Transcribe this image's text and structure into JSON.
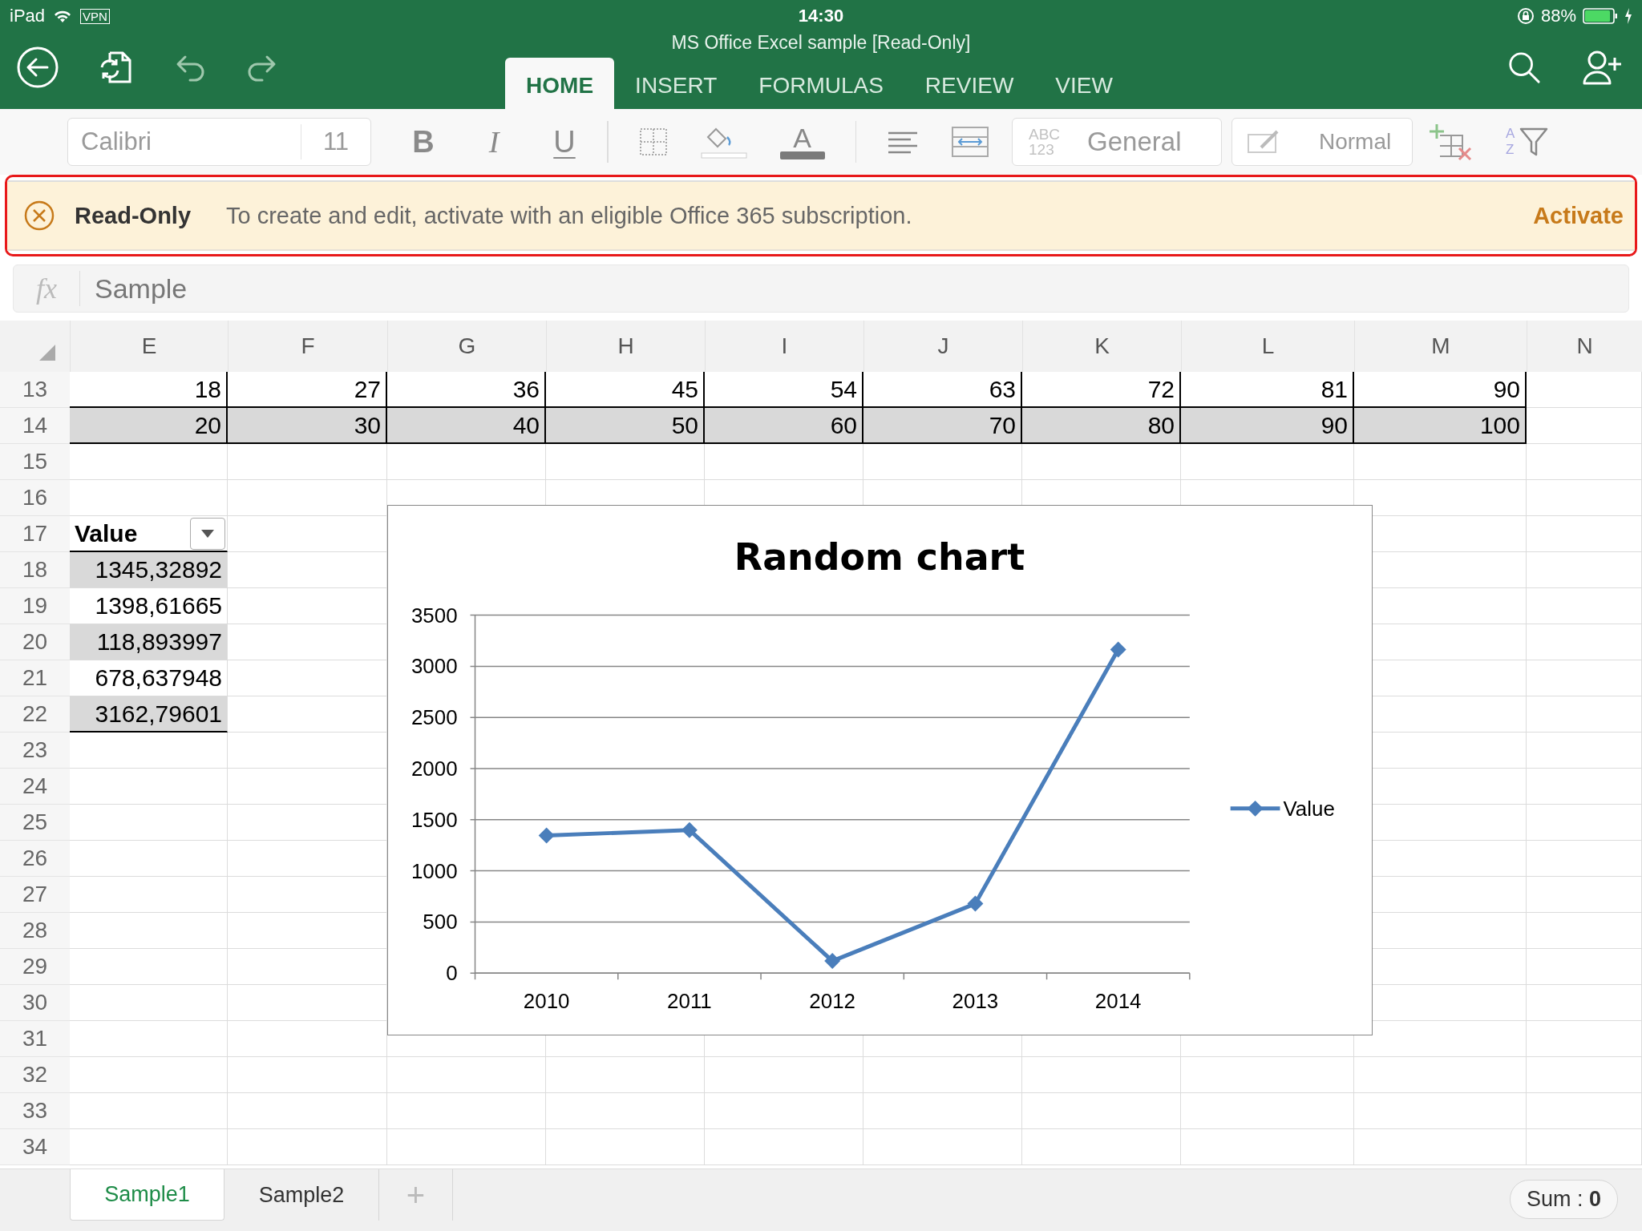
{
  "status_bar": {
    "device": "iPad",
    "vpn": "VPN",
    "time": "14:30",
    "battery": "88%"
  },
  "window": {
    "title": "MS Office Excel sample [Read-Only]"
  },
  "tabs": [
    {
      "label": "HOME",
      "selected": true
    },
    {
      "label": "INSERT",
      "selected": false
    },
    {
      "label": "FORMULAS",
      "selected": false
    },
    {
      "label": "REVIEW",
      "selected": false
    },
    {
      "label": "VIEW",
      "selected": false
    }
  ],
  "toolbar": {
    "font": "Calibri",
    "font_size": "11",
    "format_buttons": [
      {
        "label": "B",
        "kind": "bold"
      },
      {
        "label": "I",
        "kind": "italic"
      },
      {
        "label": "U",
        "kind": "underline"
      }
    ],
    "font_color_button": "A",
    "number_format_icon": [
      "ABC",
      "123"
    ],
    "number_format": "General",
    "cell_style": "Normal",
    "sort_letters": [
      "A",
      "Z"
    ]
  },
  "banner": {
    "title": "Read-Only",
    "message": "To create and edit, activate with an eligible Office 365 subscription.",
    "action": "Activate"
  },
  "formula_bar": {
    "icon": "fx",
    "value": "Sample"
  },
  "sheet": {
    "columns": [
      "E",
      "F",
      "G",
      "H",
      "I",
      "J",
      "K",
      "L",
      "M",
      "N"
    ],
    "rows": [
      {
        "number": "13",
        "kind": "band",
        "shaded": false,
        "values": [
          "18",
          "27",
          "36",
          "45",
          "54",
          "63",
          "72",
          "81",
          "90"
        ]
      },
      {
        "number": "14",
        "kind": "band",
        "shaded": true,
        "values": [
          "20",
          "30",
          "40",
          "50",
          "60",
          "70",
          "80",
          "90",
          "100"
        ]
      },
      {
        "number": "15",
        "kind": "blank"
      },
      {
        "number": "16",
        "kind": "blank"
      },
      {
        "number": "17",
        "kind": "table_header",
        "values": [
          "Value"
        ]
      },
      {
        "number": "18",
        "kind": "table_value",
        "shaded": true,
        "values": [
          "1345,32892"
        ]
      },
      {
        "number": "19",
        "kind": "table_value",
        "shaded": false,
        "values": [
          "1398,61665"
        ]
      },
      {
        "number": "20",
        "kind": "table_value",
        "shaded": true,
        "values": [
          "118,893997"
        ]
      },
      {
        "number": "21",
        "kind": "table_value",
        "shaded": false,
        "values": [
          "678,637948"
        ]
      },
      {
        "number": "22",
        "kind": "table_value",
        "shaded": true,
        "values": [
          "3162,79601"
        ]
      },
      {
        "number": "23",
        "kind": "blank"
      },
      {
        "number": "24",
        "kind": "blank"
      },
      {
        "number": "25",
        "kind": "blank"
      },
      {
        "number": "26",
        "kind": "blank"
      },
      {
        "number": "27",
        "kind": "blank"
      },
      {
        "number": "28",
        "kind": "blank"
      },
      {
        "number": "29",
        "kind": "blank"
      },
      {
        "number": "30",
        "kind": "blank"
      },
      {
        "number": "31",
        "kind": "blank"
      },
      {
        "number": "32",
        "kind": "blank"
      },
      {
        "number": "33",
        "kind": "blank"
      },
      {
        "number": "34",
        "kind": "blank"
      }
    ]
  },
  "chart": {
    "chart_data": {
      "type": "line",
      "title": "Random chart",
      "categories": [
        "2010",
        "2011",
        "2012",
        "2013",
        "2014"
      ],
      "series": [
        {
          "name": "Value",
          "color": "#4a7ebb",
          "marker": "diamond",
          "values": [
            1345,
            1399,
            119,
            679,
            3163
          ]
        }
      ],
      "grid": true,
      "ylim": [
        0,
        3500
      ],
      "yticks": [
        0,
        500,
        1000,
        1500,
        2000,
        2500,
        3000,
        3500
      ]
    }
  },
  "sheet_tabs": [
    {
      "label": "Sample1",
      "selected": true
    },
    {
      "label": "Sample2",
      "selected": false
    }
  ],
  "add_sheet": "+",
  "sum": "Sum : **0**"
}
